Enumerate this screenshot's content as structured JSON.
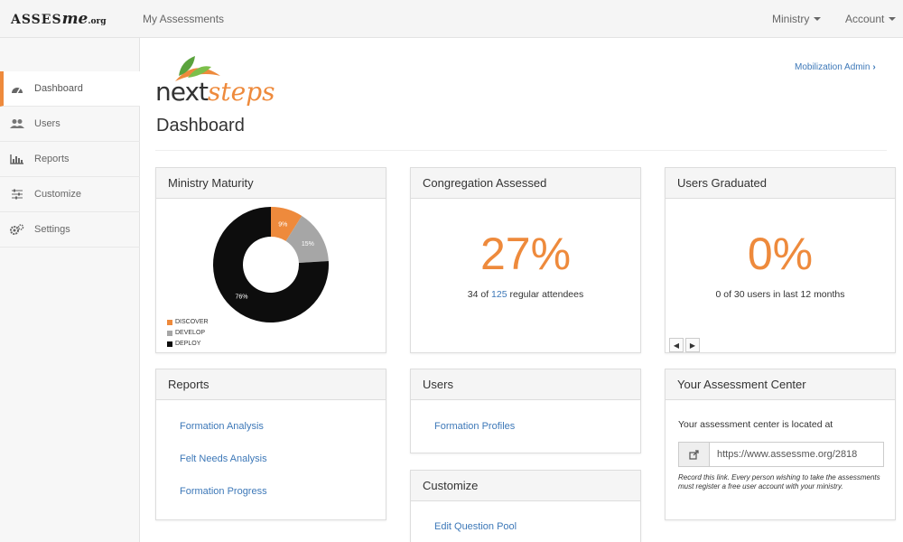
{
  "navbar": {
    "brand": {
      "prefix": "ASSES",
      "script": "me",
      "suffix": ".org"
    },
    "my_assessments": "My Assessments",
    "ministry": "Ministry",
    "account": "Account"
  },
  "sidebar": {
    "items": [
      {
        "label": "Dashboard",
        "icon": "dashboard-icon"
      },
      {
        "label": "Users",
        "icon": "users-icon"
      },
      {
        "label": "Reports",
        "icon": "chart-icon"
      },
      {
        "label": "Customize",
        "icon": "sliders-icon"
      },
      {
        "label": "Settings",
        "icon": "gears-icon"
      }
    ]
  },
  "header": {
    "logo": {
      "next": "next",
      "steps": "steps"
    },
    "title": "Dashboard",
    "mobilization_link": "Mobilization Admin"
  },
  "colors": {
    "accent": "#ee8a3c",
    "link": "#3d78b8",
    "develop": "#a6a6a6",
    "deploy": "#0d0d0d"
  },
  "ministry_maturity": {
    "title": "Ministry Maturity",
    "legend": [
      "DISCOVER",
      "DEVELOP",
      "DEPLOY"
    ]
  },
  "chart_data": {
    "type": "pie",
    "categories": [
      "DISCOVER",
      "DEVELOP",
      "DEPLOY"
    ],
    "values": [
      9,
      15,
      76
    ],
    "labels": [
      "9%",
      "15%",
      "76%"
    ]
  },
  "congregation": {
    "title": "Congregation Assessed",
    "value": "27%",
    "sub_prefix": "34 of ",
    "sub_link": "125",
    "sub_suffix": " regular attendees"
  },
  "graduated": {
    "title": "Users Graduated",
    "value": "0%",
    "sub": "0 of 30 users in last 12 months"
  },
  "reports": {
    "title": "Reports",
    "links": [
      "Formation Analysis",
      "Felt Needs Analysis",
      "Formation Progress"
    ]
  },
  "users": {
    "title": "Users",
    "links": [
      "Formation Profiles"
    ]
  },
  "customize": {
    "title": "Customize",
    "links": [
      "Edit Question Pool"
    ]
  },
  "assessment_center": {
    "title": "Your Assessment Center",
    "text": "Your assessment center is located at",
    "url": "https://www.assessme.org/2818",
    "note": "Record this link. Every person wishing to take the assessments must register a free user account with your ministry."
  }
}
